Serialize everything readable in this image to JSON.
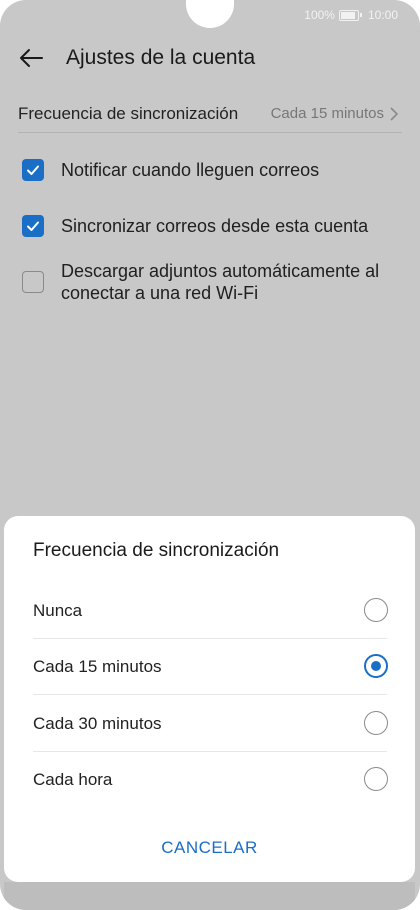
{
  "status_bar": {
    "battery": "100%",
    "time": "10:00"
  },
  "header": {
    "title": "Ajustes de la cuenta",
    "back_icon": "arrow-left-icon"
  },
  "sync_row": {
    "label": "Frecuencia de sincronización",
    "value": "Cada 15 minutos"
  },
  "settings": [
    {
      "label": "Notificar cuando lleguen correos",
      "checked": true
    },
    {
      "label": "Sincronizar correos desde esta cuenta",
      "checked": true
    },
    {
      "label_line1": "Descargar adjuntos automáticamente al",
      "label_line2": "conectar a una red Wi-Fi",
      "checked": false
    }
  ],
  "dialog": {
    "title": "Frecuencia de sincronización",
    "options": [
      {
        "label": "Nunca",
        "selected": false
      },
      {
        "label": "Cada 15 minutos",
        "selected": true
      },
      {
        "label": "Cada 30 minutos",
        "selected": false
      },
      {
        "label": "Cada hora",
        "selected": false
      }
    ],
    "cancel_label": "CANCELAR"
  },
  "colors": {
    "accent": "#1a6ec5",
    "dim_background": "#c8c8c8"
  }
}
